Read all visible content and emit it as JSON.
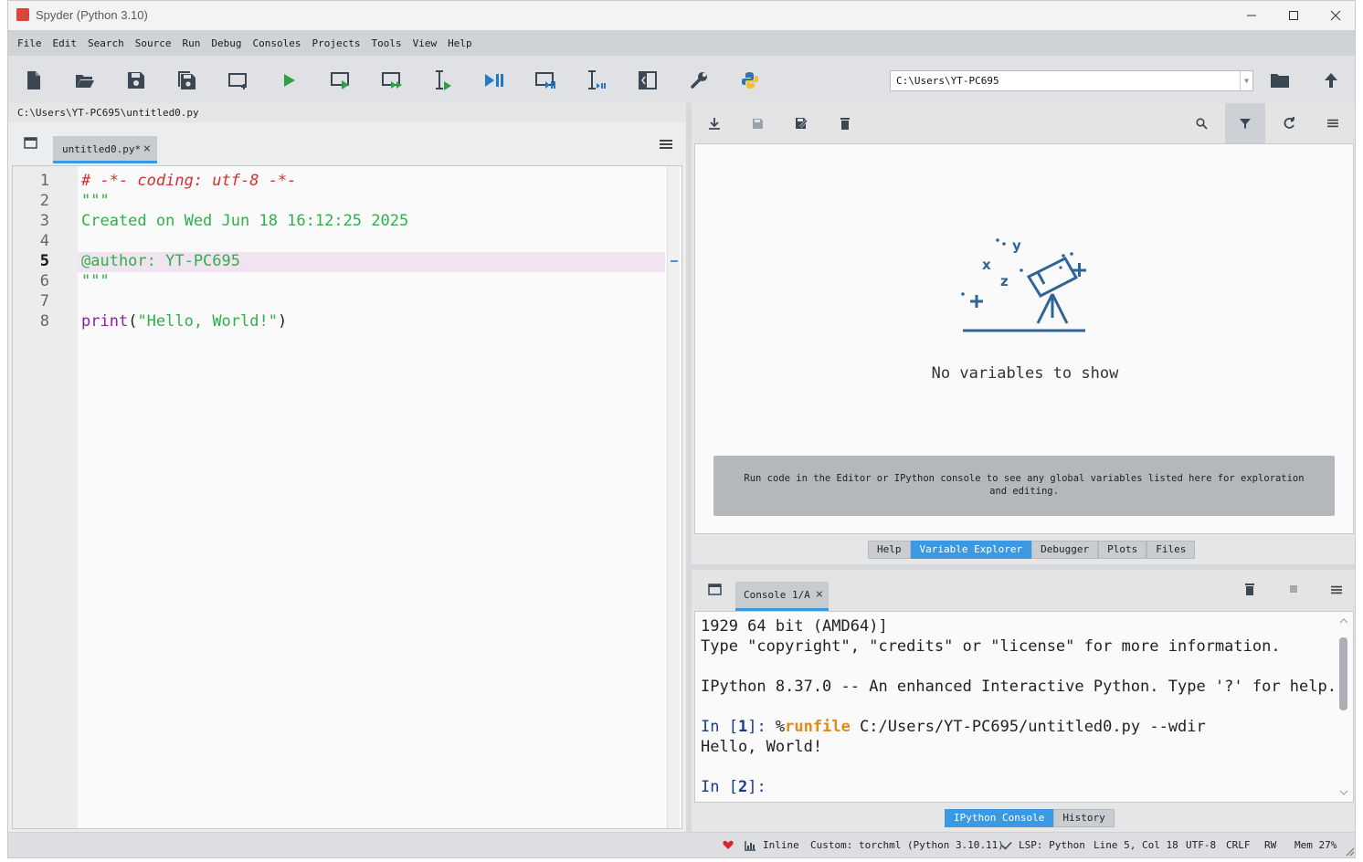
{
  "window": {
    "title": "Spyder (Python 3.10)"
  },
  "menu": [
    "File",
    "Edit",
    "Search",
    "Source",
    "Run",
    "Debug",
    "Consoles",
    "Projects",
    "Tools",
    "View",
    "Help"
  ],
  "toolbar": {
    "icons": [
      "new-file-icon",
      "open-file-icon",
      "save-icon",
      "save-all-icon",
      "create-cell-icon",
      "run-file-icon",
      "run-cell-icon",
      "run-cell-advance-icon",
      "run-selection-icon",
      "debug-file-icon",
      "debug-cell-icon",
      "debug-selection-icon",
      "maximize-pane-icon",
      "preferences-icon",
      "python-path-icon"
    ],
    "working_dir": "C:\\Users\\YT-PC695"
  },
  "editor": {
    "path": "C:\\Users\\YT-PC695\\untitled0.py",
    "tab": "untitled0.py*",
    "tab_close": "×",
    "lines": [
      {
        "n": "1",
        "text": "# -*- coding: utf-8 -*-",
        "color": "#d32f2f",
        "italic": true
      },
      {
        "n": "2",
        "text": "\"\"\"",
        "color": "#2fb04a"
      },
      {
        "n": "3",
        "text": "Created on Wed Jun 18 16:12:25 2025",
        "color": "#2fb04a"
      },
      {
        "n": "4",
        "text": "",
        "color": "#2fb04a"
      },
      {
        "n": "5",
        "text": "@author: YT-PC695",
        "color": "#2fb04a",
        "current": true
      },
      {
        "n": "6",
        "text": "\"\"\"",
        "color": "#2fb04a"
      },
      {
        "n": "7",
        "text": "",
        "color": "#222"
      },
      {
        "n": "8",
        "parts": [
          {
            "t": "print",
            "c": "#8e1fa6"
          },
          {
            "t": "(",
            "c": "#222"
          },
          {
            "t": "\"Hello, World!\"",
            "c": "#2fb04a"
          },
          {
            "t": ")",
            "c": "#222"
          }
        ]
      }
    ]
  },
  "variable_explorer": {
    "empty_title": "No variables to show",
    "hint": "Run code in the Editor or IPython console to see any global variables listed here for exploration and editing.",
    "tabs": [
      {
        "label": "Help",
        "active": false
      },
      {
        "label": "Variable Explorer",
        "active": true
      },
      {
        "label": "Debugger",
        "active": false
      },
      {
        "label": "Plots",
        "active": false
      },
      {
        "label": "Files",
        "active": false
      }
    ]
  },
  "console": {
    "tab": "Console 1/A",
    "tab_close": "×",
    "lines": [
      {
        "parts": [
          {
            "t": "1929 64 bit (AMD64)]",
            "c": "#222"
          }
        ]
      },
      {
        "parts": [
          {
            "t": "Type \"copyright\", \"credits\" or \"license\" for more information.",
            "c": "#222"
          }
        ]
      },
      {
        "parts": []
      },
      {
        "parts": [
          {
            "t": "IPython 8.37.0 -- An enhanced Interactive Python. Type '?' for help.",
            "c": "#222"
          }
        ]
      },
      {
        "parts": []
      },
      {
        "parts": [
          {
            "t": "In [",
            "c": "#1a3a8a"
          },
          {
            "t": "1",
            "c": "#1a3a8a",
            "b": true
          },
          {
            "t": "]: ",
            "c": "#1a3a8a"
          },
          {
            "t": "%",
            "c": "#222"
          },
          {
            "t": "runfile",
            "c": "#e08a1e",
            "b": true
          },
          {
            "t": " C:/Users/YT-PC695/untitled0.py --wdir",
            "c": "#222"
          }
        ]
      },
      {
        "parts": [
          {
            "t": "Hello, World!",
            "c": "#222"
          }
        ]
      },
      {
        "parts": []
      },
      {
        "parts": [
          {
            "t": "In [",
            "c": "#1a3a8a"
          },
          {
            "t": "2",
            "c": "#1a3a8a",
            "b": true
          },
          {
            "t": "]: ",
            "c": "#1a3a8a"
          }
        ]
      }
    ],
    "tabs": [
      {
        "label": "IPython Console",
        "active": true
      },
      {
        "label": "History",
        "active": false
      }
    ]
  },
  "status": {
    "inline": "Inline",
    "env": "Custom: torchml (Python 3.10.11)",
    "lsp": "LSP: Python",
    "cursor": "Line 5, Col 18",
    "encoding": "UTF-8",
    "eol": "CRLF",
    "mode": "RW",
    "mem": "Mem 27%"
  },
  "colors": {
    "accent": "#3a99e0",
    "brand": "#d9453c"
  }
}
